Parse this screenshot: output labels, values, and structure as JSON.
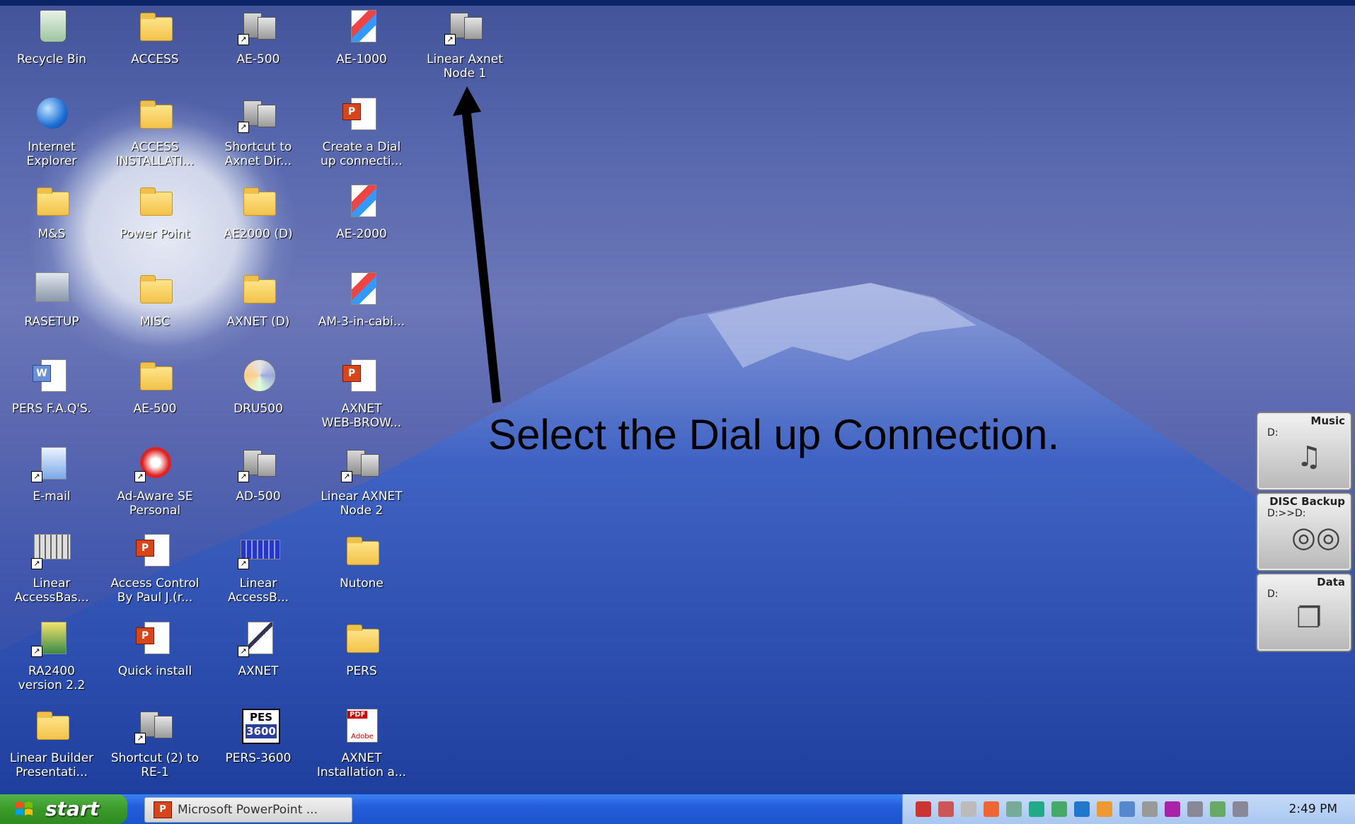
{
  "desktop": {
    "icons": [
      {
        "label": "Recycle Bin",
        "type": "recycle-bin-icon"
      },
      {
        "label": "ACCESS",
        "type": "folder-icon"
      },
      {
        "label": "AE-500",
        "type": "network-shortcut-icon"
      },
      {
        "label": "AE-1000",
        "type": "ae-app-icon"
      },
      {
        "label": "Linear Axnet\nNode 1",
        "type": "network-shortcut-icon"
      },
      {
        "label": "Internet\nExplorer",
        "type": "internet-explorer-icon"
      },
      {
        "label": "ACCESS\nINSTALLATI...",
        "type": "folder-icon"
      },
      {
        "label": "Shortcut to\nAxnet Dir...",
        "type": "network-shortcut-icon"
      },
      {
        "label": "Create a Dial\nup connecti...",
        "type": "powerpoint-document-icon"
      },
      {
        "label": "M&S",
        "type": "folder-icon"
      },
      {
        "label": "Power Point",
        "type": "folder-icon"
      },
      {
        "label": "AE2000 (D)",
        "type": "folder-icon"
      },
      {
        "label": "AE-2000",
        "type": "ae-app-icon"
      },
      {
        "label": "RASETUP",
        "type": "rasetup-icon"
      },
      {
        "label": "MISC",
        "type": "folder-icon"
      },
      {
        "label": "AXNET (D)",
        "type": "folder-icon"
      },
      {
        "label": "AM-3-in-cabi...",
        "type": "ae-app-icon"
      },
      {
        "label": "PERS F.A.Q'S.",
        "type": "document-icon"
      },
      {
        "label": "AE-500",
        "type": "folder-icon"
      },
      {
        "label": "DRU500",
        "type": "cd-icon"
      },
      {
        "label": "AXNET\nWEB-BROW...",
        "type": "powerpoint-document-icon"
      },
      {
        "label": "E-mail",
        "type": "email-icon"
      },
      {
        "label": "Ad-Aware SE\nPersonal",
        "type": "ad-aware-icon"
      },
      {
        "label": "AD-500",
        "type": "network-shortcut-icon"
      },
      {
        "label": "Linear AXNET\nNode 2",
        "type": "network-shortcut-icon"
      },
      {
        "label": "Linear\nAccessBas...",
        "type": "keypad-icon"
      },
      {
        "label": "Access Control\nBy Paul J.(r...",
        "type": "powerpoint-document-icon"
      },
      {
        "label": "Linear\nAccessB...",
        "type": "keypad-blue-icon"
      },
      {
        "label": "Nutone",
        "type": "folder-icon"
      },
      {
        "label": "RA2400\nversion 2.2",
        "type": "ra2400-icon"
      },
      {
        "label": "Quick install",
        "type": "powerpoint-document-icon"
      },
      {
        "label": "AXNET",
        "type": "axnet-shortcut-icon"
      },
      {
        "label": "PERS",
        "type": "folder-icon"
      },
      {
        "label": "Linear Builder\nPresentati...",
        "type": "folder-icon"
      },
      {
        "label": "Shortcut (2) to\nRE-1",
        "type": "network-shortcut-icon"
      },
      {
        "label": "PERS-3600",
        "type": "pes-3600-icon"
      },
      {
        "label": "AXNET\nInstallation a...",
        "type": "pdf-icon"
      }
    ],
    "pes_icon_text": [
      "PES",
      "3600"
    ],
    "pdf_icon_text": [
      "PDF",
      "Adobe"
    ]
  },
  "annotation": {
    "text": "Select the Dial up Connection."
  },
  "side_widgets": [
    {
      "title": "Music",
      "drive": "D:",
      "icon": "music-note-icon"
    },
    {
      "title": "DISC Backup",
      "drive": "D:>>D:",
      "icon": "disc-icon"
    },
    {
      "title": "Data",
      "drive": "D:",
      "icon": "data-files-icon"
    }
  ],
  "taskbar": {
    "start_label": "start",
    "task_button_label": "Microsoft PowerPoint ...",
    "clock": "2:49 PM"
  },
  "colors": {
    "taskbar_blue": "#245edb",
    "start_green": "#3a9b2a",
    "tray_bg": "#c7dbf8",
    "sky": "#6b77b8",
    "mountain": "#2848a6"
  }
}
